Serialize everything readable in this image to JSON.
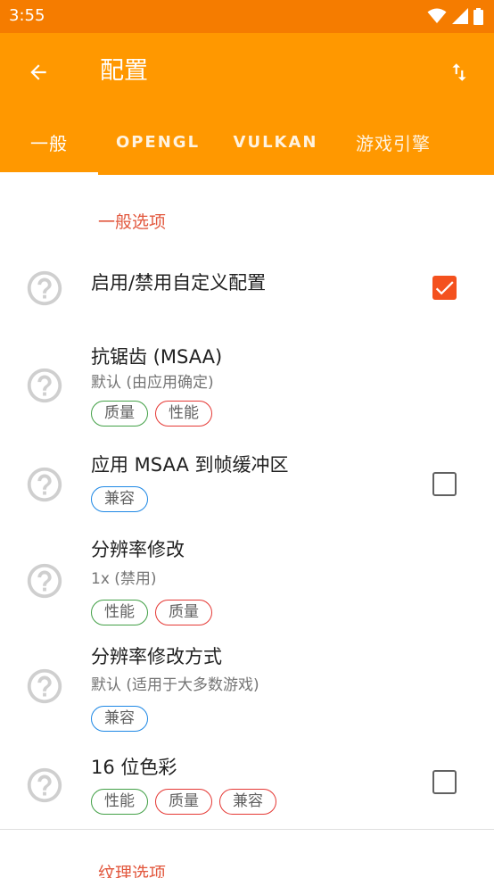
{
  "status_bar": {
    "time": "3:55",
    "icons": [
      "wifi-icon",
      "signal-icon",
      "battery-icon"
    ]
  },
  "app_bar": {
    "title": "配置",
    "back_icon": "arrow-left-icon",
    "action_icon": "sort-swap-icon"
  },
  "tabs": [
    {
      "label": "一般",
      "selected": true
    },
    {
      "label": "OPENGL",
      "selected": false
    },
    {
      "label": "VULKAN",
      "selected": false
    },
    {
      "label": "游戏引擎",
      "selected": false
    }
  ],
  "sections": [
    {
      "header": "一般选项",
      "settings": [
        {
          "title": "启用/禁用自定义配置",
          "summary": "",
          "chips": [],
          "checkbox": "checked"
        },
        {
          "title": "抗锯齿 (MSAA)",
          "summary": "默认 (由应用确定)",
          "chips": [
            {
              "label": "质量",
              "color": "green"
            },
            {
              "label": "性能",
              "color": "red"
            }
          ],
          "checkbox": "none"
        },
        {
          "title": "应用 MSAA 到帧缓冲区",
          "summary": "",
          "chips": [
            {
              "label": "兼容",
              "color": "blue"
            }
          ],
          "checkbox": "unchecked"
        },
        {
          "title": "分辨率修改",
          "summary": "1x (禁用)",
          "chips": [
            {
              "label": "性能",
              "color": "green"
            },
            {
              "label": "质量",
              "color": "red"
            }
          ],
          "checkbox": "none"
        },
        {
          "title": "分辨率修改方式",
          "summary": "默认 (适用于大多数游戏)",
          "chips": [
            {
              "label": "兼容",
              "color": "blue"
            }
          ],
          "checkbox": "none"
        },
        {
          "title": "16 位色彩",
          "summary": "",
          "chips": [
            {
              "label": "性能",
              "color": "green"
            },
            {
              "label": "质量",
              "color": "red"
            },
            {
              "label": "兼容",
              "color": "red"
            }
          ],
          "checkbox": "unchecked"
        }
      ]
    },
    {
      "header": "纹理选项",
      "settings": []
    }
  ],
  "colors": {
    "status_bar": "#F57C00",
    "app_bar": "#FF9800",
    "accent": "#E2583E",
    "checkbox_checked": "#F4511E",
    "chip_green": "#43A047",
    "chip_red": "#E53935",
    "chip_blue": "#1E88E5"
  }
}
